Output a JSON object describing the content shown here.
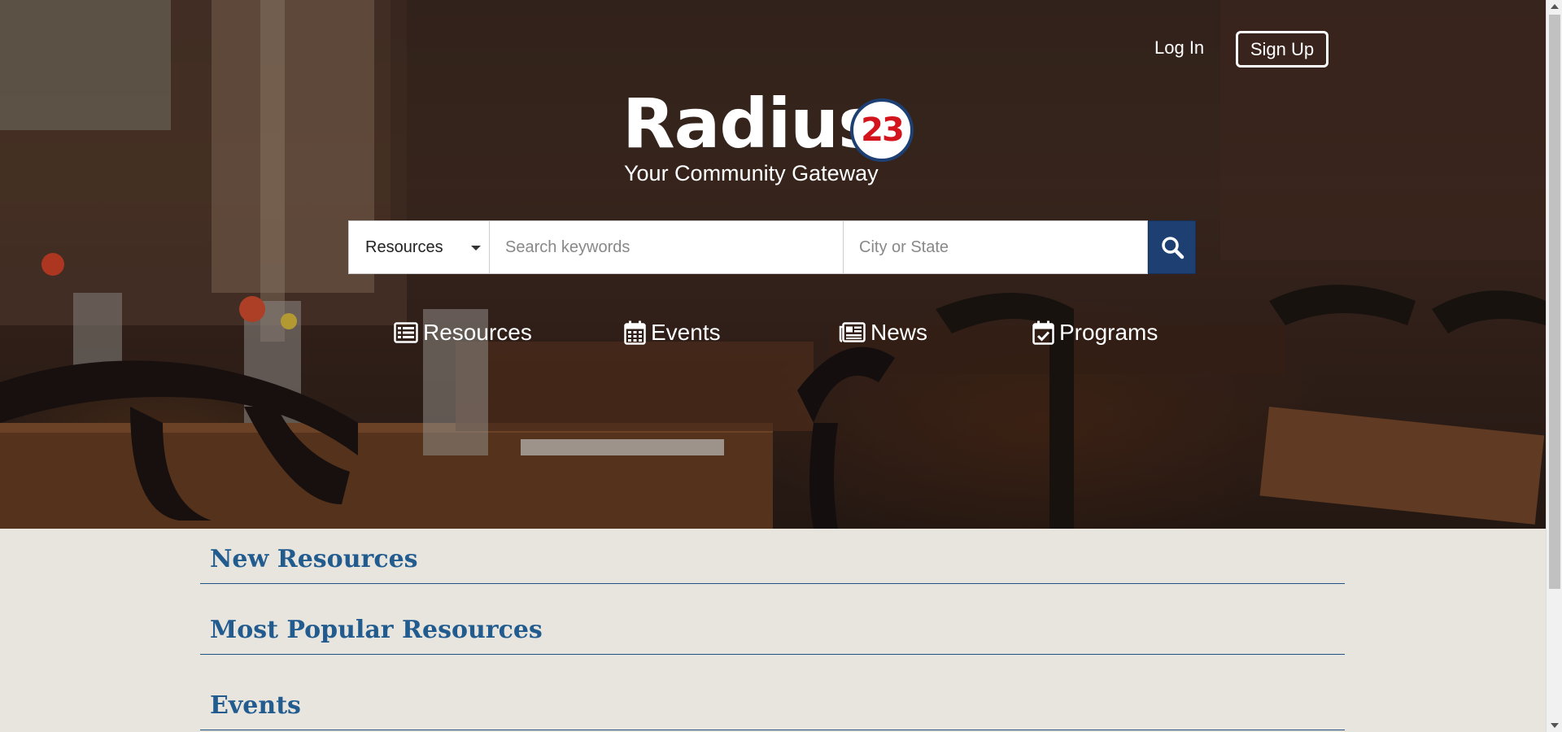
{
  "header": {
    "login_label": "Log In",
    "signup_label": "Sign Up"
  },
  "logo": {
    "name": "Radius",
    "badge": "23",
    "tagline": "Your Community Gateway"
  },
  "search": {
    "category_selected": "Resources",
    "keywords_placeholder": "Search keywords",
    "location_placeholder": "City or State",
    "button_icon": "search-icon"
  },
  "nav": {
    "items": [
      {
        "label": "Resources",
        "icon": "list-icon"
      },
      {
        "label": "Events",
        "icon": "calendar-icon"
      },
      {
        "label": "News",
        "icon": "newspaper-icon"
      },
      {
        "label": "Programs",
        "icon": "calendar-check-icon"
      }
    ]
  },
  "sections": [
    {
      "title": "New Resources"
    },
    {
      "title": "Most Popular Resources"
    },
    {
      "title": "Events"
    }
  ],
  "colors": {
    "primary": "#1d3f72",
    "heading": "#225c8f",
    "badge_red": "#d3141c",
    "page_bg": "#e8e5df"
  }
}
